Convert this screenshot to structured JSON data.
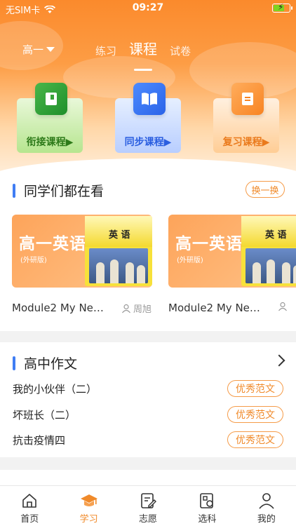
{
  "status_bar": {
    "carrier": "无SIM卡",
    "time": "09:27",
    "battery_level": 0.7
  },
  "header": {
    "grade": "高一",
    "tabs": [
      {
        "label": "练习",
        "active": false
      },
      {
        "label": "课程",
        "active": true
      },
      {
        "label": "试卷",
        "active": false
      }
    ],
    "course_cards": [
      {
        "label": "衔接课程▶",
        "icon": "book-bookmark-icon",
        "color": "#2d7a19"
      },
      {
        "label": "同步课程▶",
        "icon": "open-book-icon",
        "color": "#2a5ee0"
      },
      {
        "label": "复习课程▶",
        "icon": "notes-icon",
        "color": "#ea7a1c"
      }
    ]
  },
  "watch_section": {
    "title": "同学们都在看",
    "swap_label": "换一换",
    "videos": [
      {
        "cover_title": "高一英语",
        "cover_sub": "(外研版)",
        "book_word": "英 语",
        "caption": "Module2 My Ne…",
        "author": "周旭"
      },
      {
        "cover_title": "高一英语",
        "cover_sub": "(外研版)",
        "book_word": "英 语",
        "caption": "Module2 My Ne…",
        "author": ""
      }
    ]
  },
  "essay_section": {
    "title": "高中作文",
    "items": [
      {
        "title": "我的小伙伴（二）",
        "badge": "优秀范文"
      },
      {
        "title": "坏班长（二）",
        "badge": "优秀范文"
      },
      {
        "title": "抗击疫情四",
        "badge": "优秀范文"
      }
    ]
  },
  "bottom_nav": [
    {
      "label": "首页",
      "icon": "home-icon",
      "active": false
    },
    {
      "label": "学习",
      "icon": "graduation-cap-icon",
      "active": true
    },
    {
      "label": "志愿",
      "icon": "edit-form-icon",
      "active": false
    },
    {
      "label": "选科",
      "icon": "subject-select-icon",
      "active": false
    },
    {
      "label": "我的",
      "icon": "user-icon",
      "active": false
    }
  ],
  "colors": {
    "accent": "#f08a2a",
    "title_bar": "#3f7df4"
  }
}
